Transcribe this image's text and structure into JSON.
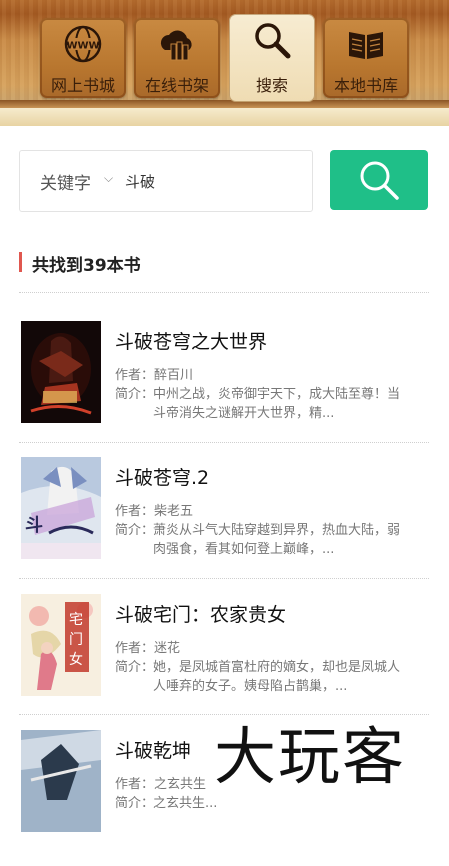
{
  "tabs": [
    {
      "label": "网上书城",
      "icon": "globe-www-icon"
    },
    {
      "label": "在线书架",
      "icon": "cloud-books-icon"
    },
    {
      "label": "搜索",
      "icon": "magnifier-icon"
    },
    {
      "label": "本地书库",
      "icon": "open-book-icon"
    }
  ],
  "search": {
    "type_label": "关键字",
    "query": "斗破",
    "button_icon": "search-icon"
  },
  "results": {
    "count_text": "共找到39本书"
  },
  "author_key": "作者：",
  "intro_key": "简介：",
  "books": [
    {
      "title": "斗破苍穹之大世界",
      "author": "醉百川",
      "intro": "中州之战，炎帝御宇天下，成大陆至尊！当斗帝消失之谜解开大世界，精..."
    },
    {
      "title": "斗破苍穹.2",
      "author": "柴老五",
      "intro": "萧炎从斗气大陆穿越到异界，热血大陆，弱肉强食，看其如何登上巅峰，..."
    },
    {
      "title": "斗破宅门：农家贵女",
      "author": "迷花",
      "intro": "她，是凤城首富杜府的嫡女，却也是凤城人人唾弃的女子。姨母陷占鹊巢，..."
    },
    {
      "title": "斗破乾坤",
      "author": "之玄共生",
      "intro": "之玄共生..."
    }
  ],
  "watermark": "大玩客",
  "colors": {
    "accent": "#1fbf88",
    "marker": "#e0574f"
  }
}
